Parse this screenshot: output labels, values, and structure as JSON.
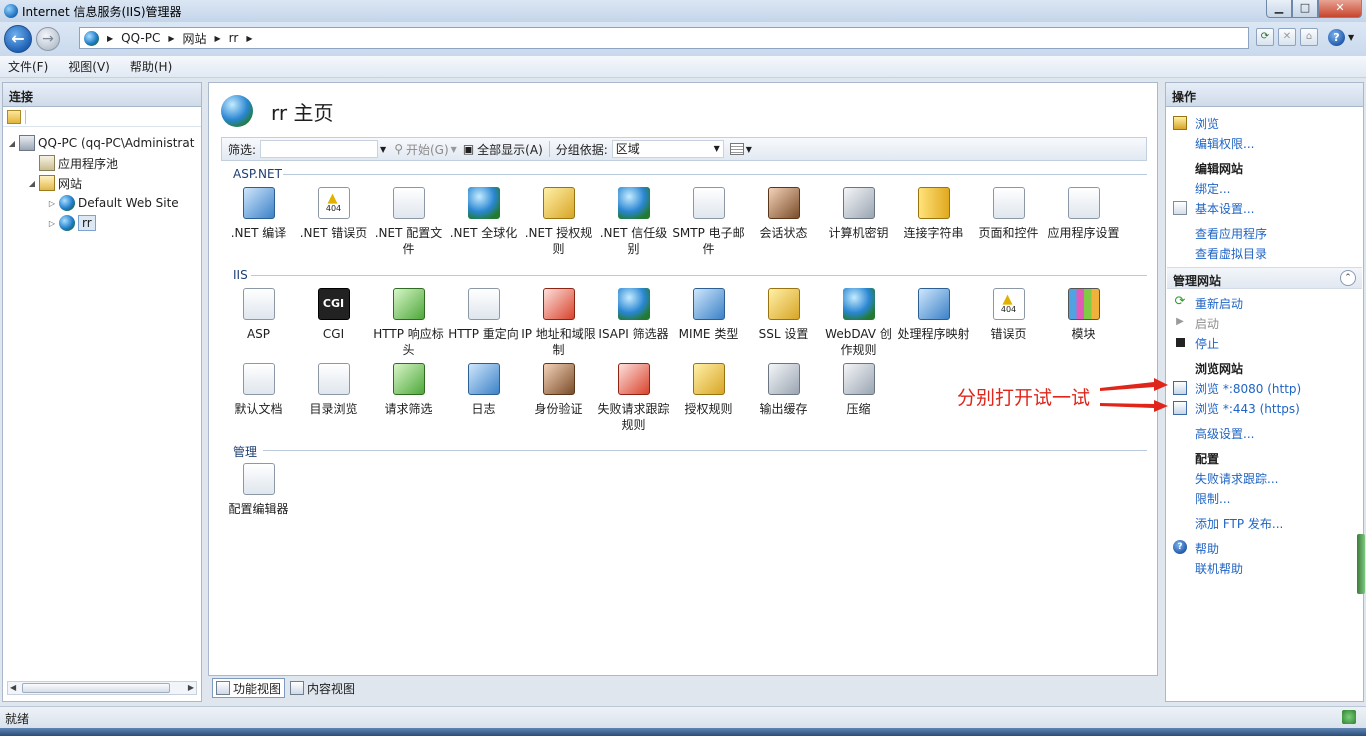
{
  "window": {
    "title": "Internet 信息服务(IIS)管理器"
  },
  "breadcrumb": [
    "QQ-PC",
    "网站",
    "rr"
  ],
  "menu": [
    "文件(F)",
    "视图(V)",
    "帮助(H)"
  ],
  "connections": {
    "header": "连接",
    "tree": [
      {
        "label": "QQ-PC (qq-PC\\Administrat",
        "expander": "◢",
        "level": 0
      },
      {
        "label": "应用程序池",
        "expander": "",
        "level": 1
      },
      {
        "label": "网站",
        "expander": "◢",
        "level": 1
      },
      {
        "label": "Default Web Site",
        "expander": "▷",
        "level": 2
      },
      {
        "label": "rr",
        "expander": "▷",
        "level": 2,
        "selected": true
      }
    ]
  },
  "main": {
    "title": "rr 主页",
    "filter_label": "筛选:",
    "start_label": "开始(G)",
    "show_all_label": "全部显示(A)",
    "group_by_label": "分组依据:",
    "group_by_value": "区域",
    "groups": {
      "aspnet": "ASP.NET",
      "iis": "IIS",
      "manage": "管理"
    },
    "aspnet_features": [
      ".NET 编译",
      ".NET 错误页",
      ".NET 配置文件",
      ".NET 全球化",
      ".NET 授权规则",
      ".NET 信任级别",
      "SMTP 电子邮件",
      "会话状态",
      "计算机密钥",
      "连接字符串",
      "页面和控件",
      "应用程序设置"
    ],
    "iis_features": [
      "ASP",
      "CGI",
      "HTTP 响应标头",
      "HTTP 重定向",
      "IP 地址和域限制",
      "ISAPI 筛选器",
      "MIME 类型",
      "SSL 设置",
      "WebDAV 创作规则",
      "处理程序映射",
      "错误页",
      "模块",
      "默认文档",
      "目录浏览",
      "请求筛选",
      "日志",
      "身份验证",
      "失败请求跟踪规则",
      "授权规则",
      "输出缓存",
      "压缩"
    ],
    "manage_features": [
      "配置编辑器"
    ],
    "icons": {
      "cgi_text": "CGI",
      "error_text": "404"
    }
  },
  "bottom_tabs": [
    "功能视图",
    "内容视图"
  ],
  "actions": {
    "header": "操作",
    "browse": "浏览",
    "edit_permissions": "编辑权限...",
    "edit_site_heading": "编辑网站",
    "bindings": "绑定...",
    "basic_settings": "基本设置...",
    "view_apps": "查看应用程序",
    "view_vdirs": "查看虚拟目录",
    "manage_site_heading": "管理网站",
    "restart": "重新启动",
    "start": "启动",
    "stop": "停止",
    "browse_site_heading": "浏览网站",
    "browse_8080": "浏览 *:8080 (http)",
    "browse_443": "浏览 *:443 (https)",
    "advanced_settings": "高级设置...",
    "config_heading": "配置",
    "failed_request_tracing": "失败请求跟踪...",
    "limits": "限制...",
    "add_ftp": "添加 FTP 发布...",
    "help": "帮助",
    "online_help": "联机帮助"
  },
  "annotation": "分别打开试一试",
  "status": "就绪",
  "colors": {
    "link": "#1f64c4",
    "annotation": "#e0261b"
  }
}
